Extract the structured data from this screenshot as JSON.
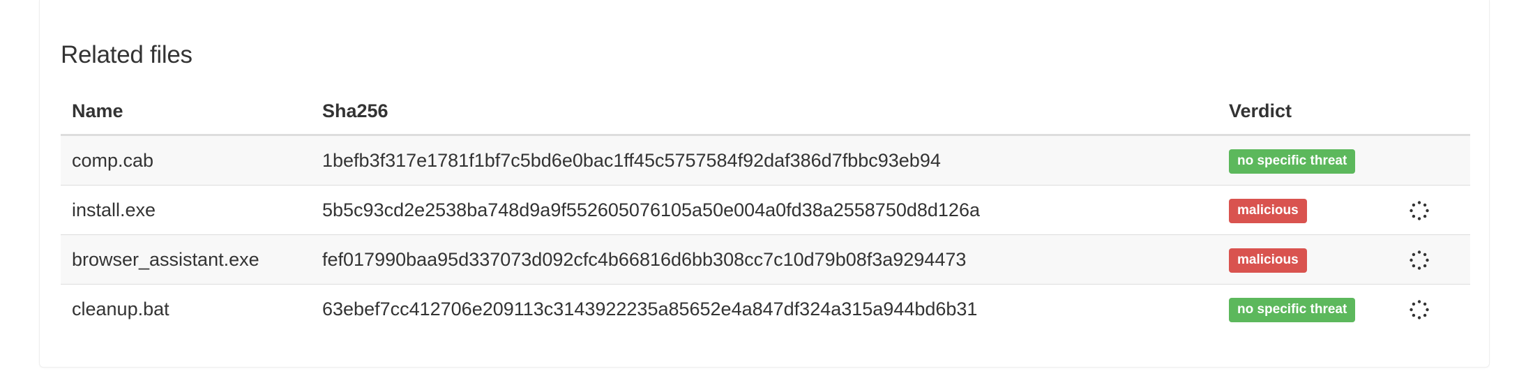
{
  "section": {
    "title": "Related files"
  },
  "table": {
    "headers": {
      "name": "Name",
      "sha256": "Sha256",
      "verdict": "Verdict"
    },
    "rows": [
      {
        "name": "comp.cab",
        "sha256": "1befb3f317e1781f1bf7c5bd6e0bac1ff45c5757584f92daf386d7fbbc93eb94",
        "verdict": "no specific threat",
        "verdict_color": "#5cb85c",
        "loading_icon": false
      },
      {
        "name": "install.exe",
        "sha256": "5b5c93cd2e2538ba748d9a9f552605076105a50e004a0fd38a2558750d8d126a",
        "verdict": "malicious",
        "verdict_color": "#d9534f",
        "loading_icon": true
      },
      {
        "name": "browser_assistant.exe",
        "sha256": "fef017990baa95d337073d092cfc4b66816d6bb308cc7c10d79b08f3a9294473",
        "verdict": "malicious",
        "verdict_color": "#d9534f",
        "loading_icon": true
      },
      {
        "name": "cleanup.bat",
        "sha256": "63ebef7cc412706e209113c3143922235a85652e4a847df324a315a944bd6b31",
        "verdict": "no specific threat",
        "verdict_color": "#5cb85c",
        "loading_icon": true
      }
    ]
  },
  "colors": {
    "clean": "#5cb85c",
    "malicious": "#d9534f",
    "stripe": "#f8f8f8",
    "border": "#dddddd"
  },
  "icons": {
    "loading": "spinner-icon"
  }
}
